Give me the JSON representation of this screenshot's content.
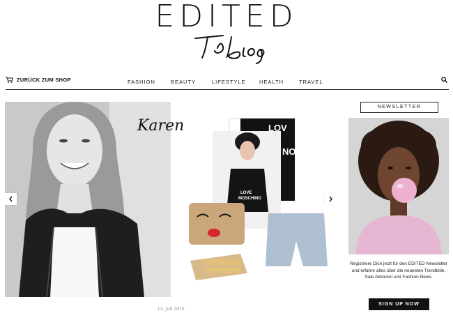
{
  "header": {
    "logo_text": "EDITED",
    "sub_logo": "The Blog"
  },
  "nav": {
    "back_to_shop": "ZURÜCK ZUM SHOP",
    "items": [
      "FASHION",
      "BEAUTY",
      "LIFESTYLE",
      "HEALTH",
      "TRAVEL"
    ],
    "cart_icon": "cart-icon",
    "search_icon": "search-icon"
  },
  "slider": {
    "caption": "Karen",
    "date": "13. Juli 2016",
    "prev_icon": "chevron-left-icon",
    "next_icon": "chevron-right-icon",
    "shirt_text": "LOVE MOSCHINO",
    "poster_text": "LOVE MO"
  },
  "sidebar": {
    "newsletter_title": "NEWSLETTER",
    "newsletter_text": "Registriere Dich jetzt für den EDITED Newsletter und erfahre alles über die neuesten Trendteile, Sale Aktionen und Fashion News.",
    "signup_label": "SIGN UP NOW"
  },
  "colors": {
    "text": "#111111",
    "bubble_pink": "#f3b7d6",
    "sweater_pink": "#e9b8d4",
    "bag_gold": "#c8a97a"
  }
}
